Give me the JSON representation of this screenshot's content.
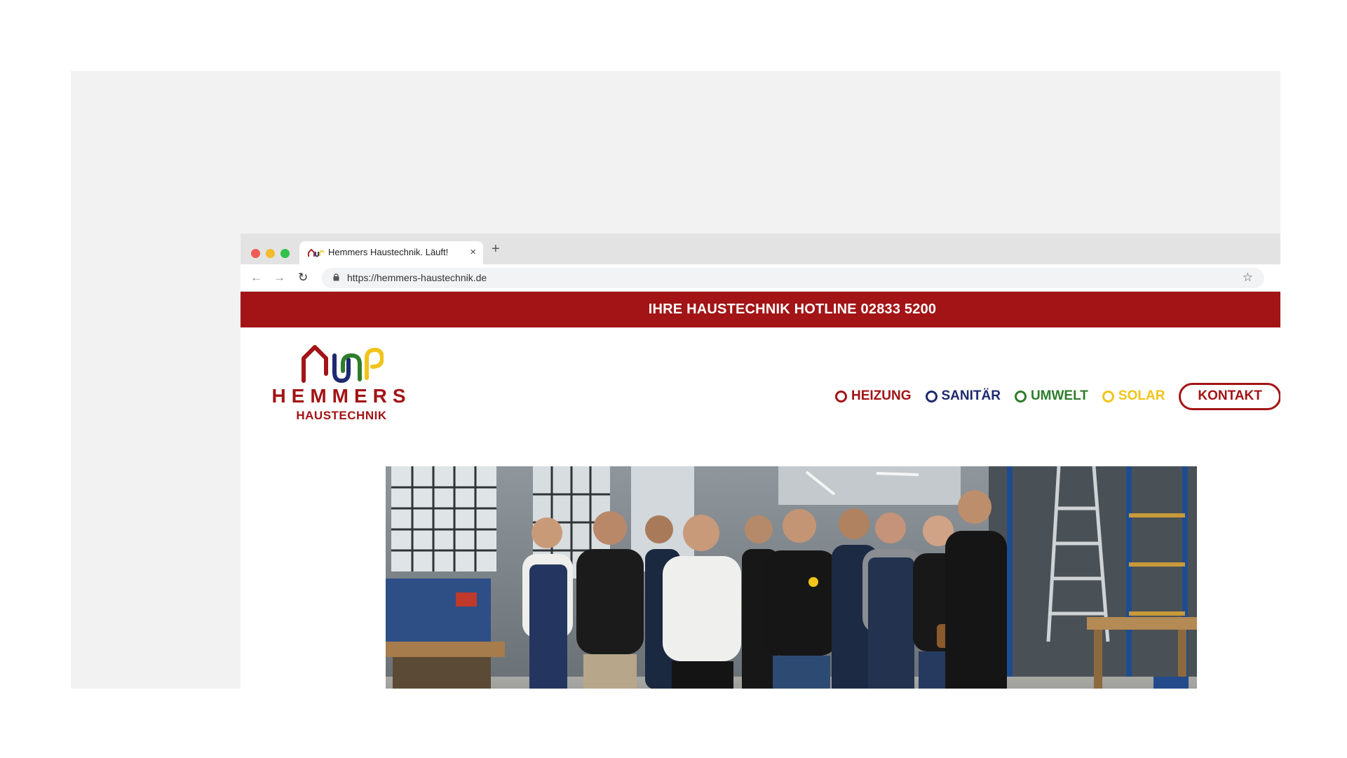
{
  "browser": {
    "tab_title": "Hemmers Haustechnik. Läuft!",
    "url": "https://hemmers-haustechnik.de",
    "icons": [
      "back-icon",
      "forward-icon",
      "reload-icon",
      "lock-icon",
      "star-icon",
      "menu-icon",
      "close-icon",
      "plus-icon"
    ]
  },
  "site": {
    "hotline": "IHRE HAUSTECHNIK HOTLINE 02833 5200",
    "logo": {
      "word": "HEMMERS",
      "sub": "HAUSTECHNIK"
    },
    "nav": [
      {
        "label": "HEIZUNG",
        "color": "#a21416"
      },
      {
        "label": "SANITÄR",
        "color": "#1d2a6e"
      },
      {
        "label": "UMWELT",
        "color": "#2e7d2a"
      },
      {
        "label": "SOLAR",
        "color": "#f0c419"
      }
    ],
    "cta": "KONTAKT",
    "colors": {
      "brand_red": "#a21416",
      "blue": "#1d2a6e",
      "green": "#2e7d2a",
      "yellow": "#f0c419"
    }
  }
}
